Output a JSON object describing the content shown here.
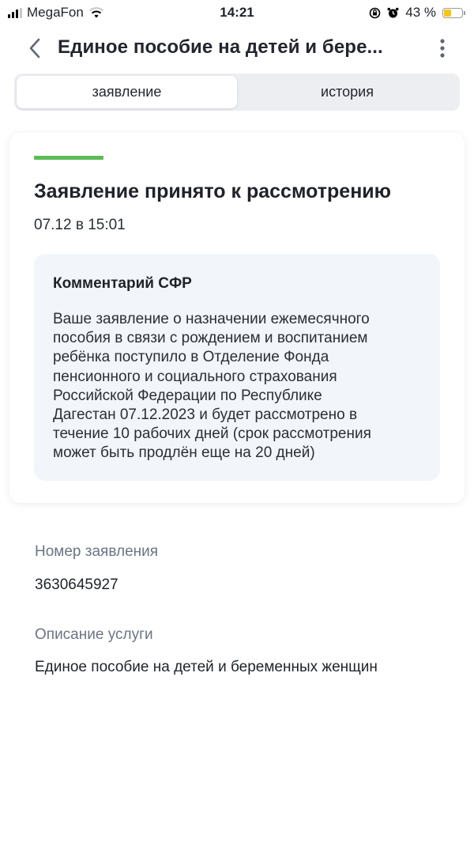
{
  "status_bar": {
    "carrier": "MegaFon",
    "time": "14:21",
    "battery_percent_label": "43 %",
    "battery_level": 0.43,
    "icons": [
      "signal-icon",
      "wifi-icon",
      "orientation-lock-icon",
      "alarm-icon",
      "battery-icon"
    ]
  },
  "header": {
    "title": "Единое пособие на детей и бере...",
    "back_icon": "chevron-left-icon",
    "more_icon": "more-vertical-icon"
  },
  "tabs": [
    {
      "label": "заявление",
      "active": true
    },
    {
      "label": "история",
      "active": false
    }
  ],
  "status_card": {
    "title": "Заявление принято к рассмотрению",
    "date": "07.12 в 15:01",
    "status_color": "#5cbc55",
    "comment": {
      "title": "Комментарий СФР",
      "text": "Ваше заявление о назначении ежемесячного\nпособия в связи с рождением и воспитанием\nребёнка поступило в Отделение Фонда\nпенсионного и социального страхования\nРоссийской Федерации по Республике\nДагестан 07.12.2023 и будет рассмотрено в\nтечение 10 рабочих дней (срок рассмотрения\nможет быть продлён еще на 20 дней)"
    }
  },
  "details": {
    "application_number_label": "Номер заявления",
    "application_number": "3630645927",
    "service_description_label": "Описание услуги",
    "service_description": "Единое пособие на детей и беременных женщин"
  }
}
